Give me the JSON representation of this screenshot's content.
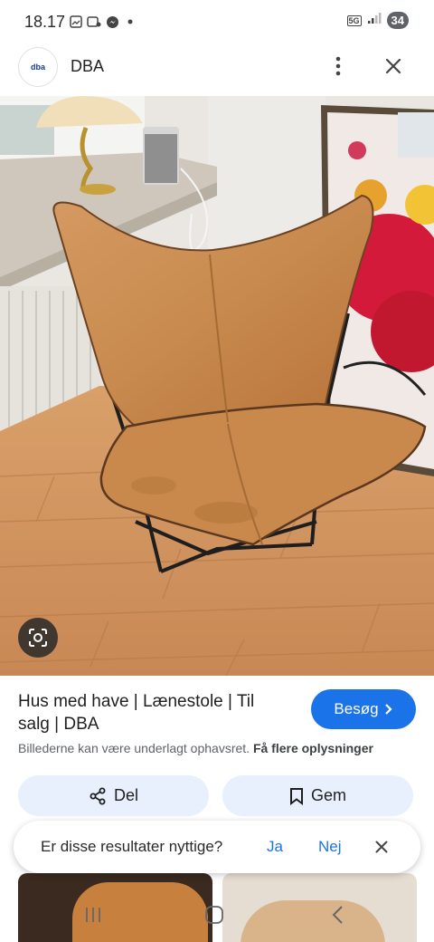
{
  "status_bar": {
    "time": "18.17",
    "battery": "34",
    "network": "5G"
  },
  "header": {
    "logo_text": "dba",
    "site_name": "DBA"
  },
  "result": {
    "title": "Hus med have | Lænestole | Til salg | DBA",
    "visit_label": "Besøg",
    "copyright_text": "Billederne kan være underlagt ophavsret.",
    "more_info_link": "Få flere oplysninger"
  },
  "actions": {
    "share_label": "Del",
    "save_label": "Gem"
  },
  "feedback": {
    "question": "Er disse resultater nyttige?",
    "yes_label": "Ja",
    "no_label": "Nej"
  },
  "colors": {
    "accent": "#1a73e8",
    "pill_bg": "#e8f0fe",
    "leather": "#c88a4e"
  },
  "icons": [
    "gallery-icon",
    "messenger-icon",
    "more-vert-icon",
    "close-icon",
    "lens-icon",
    "chevron-right-icon",
    "share-icon",
    "bookmark-icon",
    "recents-icon",
    "home-icon",
    "back-icon"
  ]
}
